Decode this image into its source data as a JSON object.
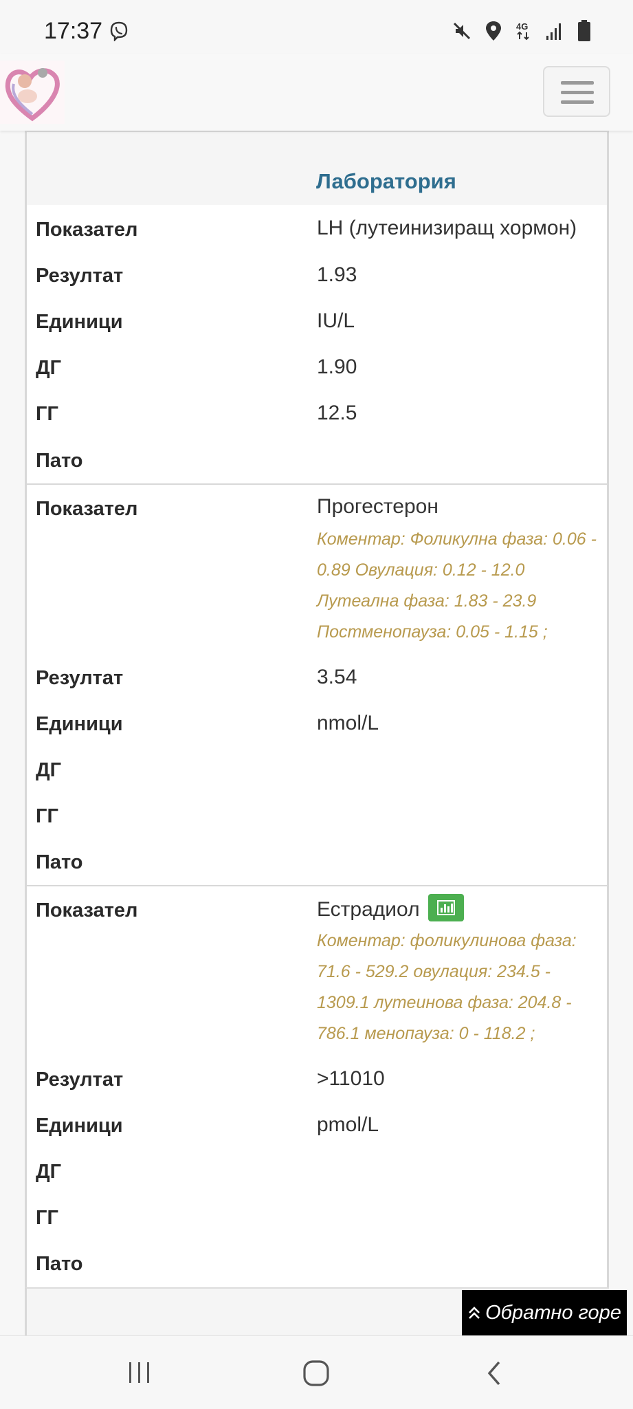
{
  "status_bar": {
    "time": "17:37",
    "network": "4G"
  },
  "section_title": "Лаборатория",
  "labels": {
    "indicator": "Показател",
    "result": "Резултат",
    "units": "Единици",
    "dg": "ДГ",
    "gg": "ГГ",
    "pato": "Пато"
  },
  "entries": [
    {
      "indicator": "LH (лутеинизиращ хормон)",
      "result": "1.93",
      "units": "IU/L",
      "dg": "1.90",
      "gg": "12.5",
      "pato": ""
    },
    {
      "indicator": "Прогестерон",
      "comment_lines": [
        "Коментар: Фоликулна фаза: 0.06 -",
        "0.89 Овулация: 0.12 - 12.0",
        "Лутеална фаза: 1.83 - 23.9",
        "Постменопауза: 0.05 - 1.15 ;"
      ],
      "result": "3.54",
      "units": "nmol/L",
      "dg": "",
      "gg": "",
      "pato": ""
    },
    {
      "indicator": "Естрадиол",
      "comment_lines": [
        "Коментар: фоликулинова фаза:",
        "71.6 - 529.2 овулация: 234.5 -",
        "1309.1 лутеинова фаза: 204.8 -",
        "786.1 менопауза: 0 - 118.2 ;"
      ],
      "result": ">11010",
      "units": "pmol/L",
      "dg": "",
      "gg": "",
      "pato": ""
    }
  ],
  "back_to_top": "Обратно горе",
  "colors": {
    "accent": "#2f6e8f",
    "comment": "#b89a4e",
    "chart_button": "#4caf50"
  },
  "icons": [
    "viber-icon",
    "mute-icon",
    "location-icon",
    "signal-icon",
    "battery-icon",
    "menu-icon",
    "chart-icon",
    "chevrons-up-icon",
    "recent-apps-icon",
    "home-icon",
    "back-icon"
  ]
}
